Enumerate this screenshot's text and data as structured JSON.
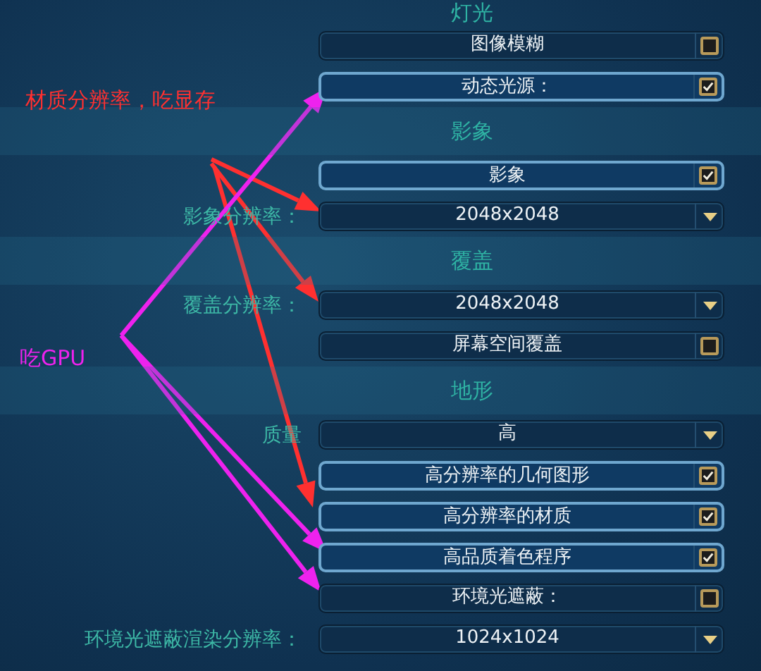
{
  "sections": [
    {
      "title": "灯光",
      "rows": [
        {
          "kind": "checkbox",
          "label": "图像模糊",
          "checked": false
        },
        {
          "kind": "checkbox",
          "label": "动态光源：",
          "checked": true
        }
      ]
    },
    {
      "title": "影象",
      "rows": [
        {
          "kind": "checkbox",
          "label": "影象",
          "checked": true
        },
        {
          "kind": "dropdown",
          "caption": "影象分辨率：",
          "value": "2048x2048"
        }
      ]
    },
    {
      "title": "覆盖",
      "rows": [
        {
          "kind": "dropdown",
          "caption": "覆盖分辨率：",
          "value": "2048x2048"
        },
        {
          "kind": "checkbox",
          "label": "屏幕空间覆盖",
          "checked": false
        }
      ]
    },
    {
      "title": "地形",
      "rows": [
        {
          "kind": "dropdown",
          "caption": "质量",
          "value": "高"
        },
        {
          "kind": "checkbox",
          "label": "高分辨率的几何图形",
          "checked": true
        },
        {
          "kind": "checkbox",
          "label": "高分辨率的材质",
          "checked": true
        },
        {
          "kind": "checkbox",
          "label": "高品质着色程序",
          "checked": true
        },
        {
          "kind": "checkbox",
          "label": "环境光遮蔽：",
          "checked": false
        },
        {
          "kind": "dropdown",
          "caption": "环境光遮蔽渲染分辨率：",
          "value": "1024x1024"
        }
      ]
    }
  ],
  "annotations": [
    {
      "text": "材质分辨率，吃显存",
      "color": "#ff3030"
    },
    {
      "text": "吃GPU",
      "color": "#ee22ee"
    }
  ]
}
